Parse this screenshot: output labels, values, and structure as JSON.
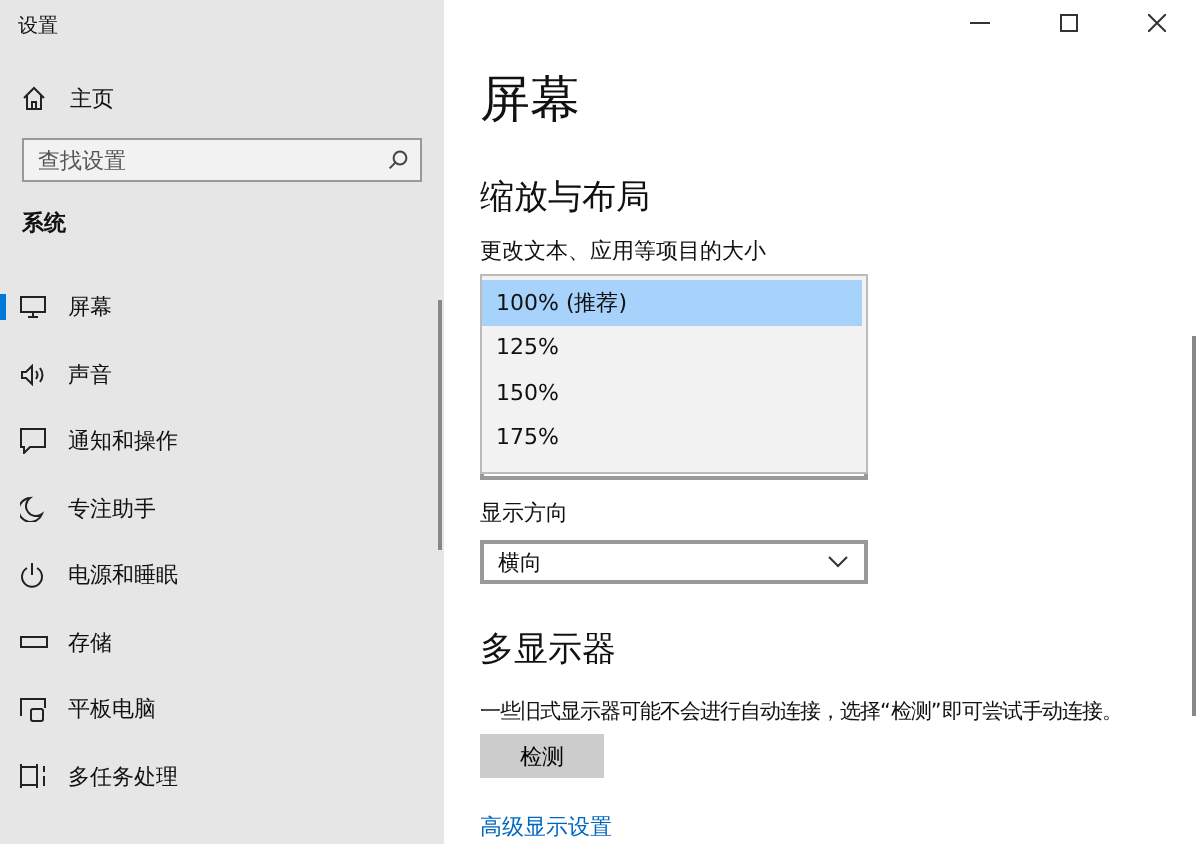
{
  "window": {
    "title": "设置"
  },
  "sidebar": {
    "home": "主页",
    "search": {
      "placeholder": "查找设置"
    },
    "section": "系统",
    "items": [
      {
        "label": "屏幕",
        "selected": true
      },
      {
        "label": "声音",
        "selected": false
      },
      {
        "label": "通知和操作",
        "selected": false
      },
      {
        "label": "专注助手",
        "selected": false
      },
      {
        "label": "电源和睡眠",
        "selected": false
      },
      {
        "label": "存储",
        "selected": false
      },
      {
        "label": "平板电脑",
        "selected": false
      },
      {
        "label": "多任务处理",
        "selected": false
      }
    ]
  },
  "content": {
    "title": "屏幕",
    "scale_section": {
      "heading": "缩放与布局",
      "scale_label": "更改文本、应用等项目的大小",
      "scale_options": [
        {
          "label": "100% (推荐)",
          "selected": true
        },
        {
          "label": "125%",
          "selected": false
        },
        {
          "label": "150%",
          "selected": false
        },
        {
          "label": "175%",
          "selected": false
        }
      ],
      "orientation_label": "显示方向",
      "orientation_value": "横向"
    },
    "multi_display": {
      "heading": "多显示器",
      "description": "一些旧式显示器可能不会进行自动连接，选择“检测”即可尝试手动连接。",
      "button": "检测",
      "link": "高级显示设置"
    }
  }
}
